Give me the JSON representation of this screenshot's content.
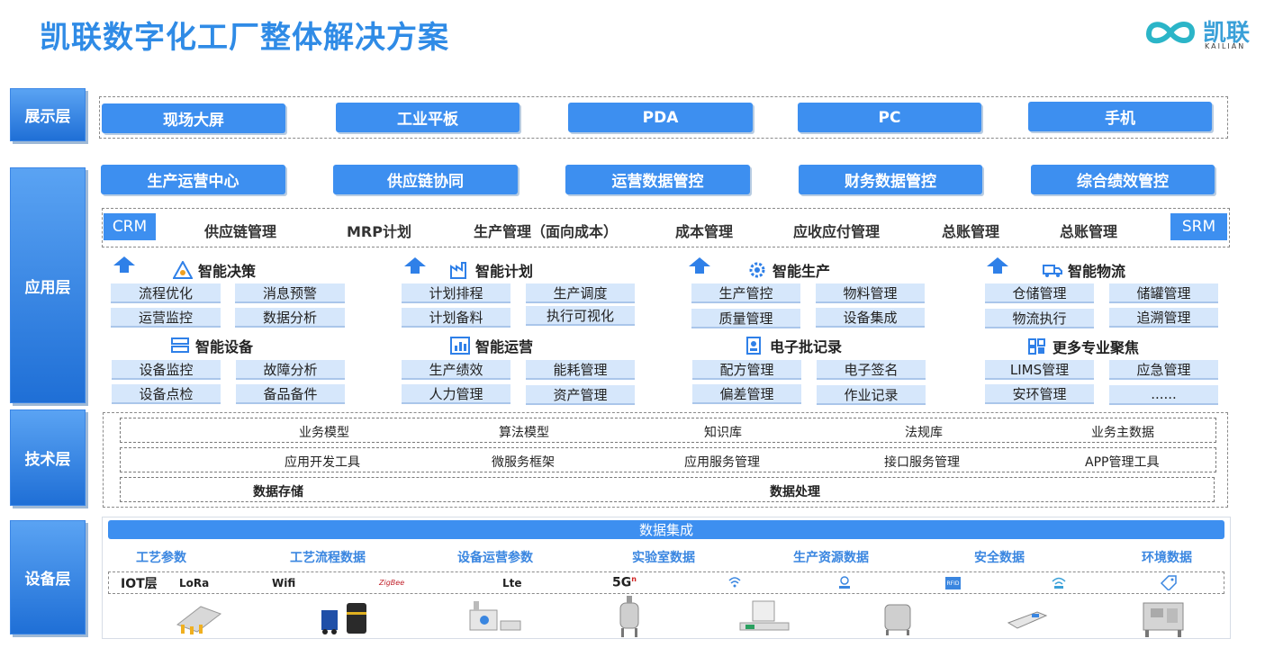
{
  "title": "凯联数字化工厂整体解决方案",
  "logo": {
    "name": "凯联",
    "sub": "KAILIAN"
  },
  "layers": {
    "display": "展示层",
    "application": "应用层",
    "technology": "技术层",
    "device": "设备层"
  },
  "display_items": [
    "现场大屏",
    "工业平板",
    "PDA",
    "PC",
    "手机"
  ],
  "centers": [
    "生产运营中心",
    "供应链协同",
    "运营数据管控",
    "财务数据管控",
    "综合绩效管控"
  ],
  "erp_row": {
    "left_tag": "CRM",
    "items": [
      "供应链管理",
      "MRP计划",
      "生产管理（面向成本）",
      "成本管理",
      "应收应付管理",
      "总账管理",
      "总账管理"
    ],
    "right_tag": "SRM"
  },
  "modules": [
    {
      "title": "智能决策",
      "icon": "decision-icon",
      "items": [
        "流程优化",
        "消息预警",
        "运营监控",
        "数据分析"
      ]
    },
    {
      "title": "智能计划",
      "icon": "factory-icon",
      "items": [
        "计划排程",
        "生产调度",
        "计划备料",
        "执行可视化"
      ]
    },
    {
      "title": "智能生产",
      "icon": "gear-icon",
      "items": [
        "生产管控",
        "物料管理",
        "质量管理",
        "设备集成"
      ]
    },
    {
      "title": "智能物流",
      "icon": "truck-icon",
      "items": [
        "仓储管理",
        "储罐管理",
        "物流执行",
        "追溯管理"
      ]
    },
    {
      "title": "智能设备",
      "icon": "server-icon",
      "items": [
        "设备监控",
        "故障分析",
        "设备点检",
        "备品备件"
      ]
    },
    {
      "title": "智能运营",
      "icon": "bar-chart-icon",
      "items": [
        "生产绩效",
        "能耗管理",
        "人力管理",
        "资产管理"
      ]
    },
    {
      "title": "电子批记录",
      "icon": "document-user-icon",
      "items": [
        "配方管理",
        "电子签名",
        "偏差管理",
        "作业记录"
      ]
    },
    {
      "title": "更多专业聚焦",
      "icon": "grid-icon",
      "items": [
        "LIMS管理",
        "应急管理",
        "安环管理",
        "......"
      ]
    }
  ],
  "tech": {
    "row1": [
      "业务模型",
      "算法模型",
      "知识库",
      "法规库",
      "业务主数据"
    ],
    "row2": [
      "应用开发工具",
      "微服务框架",
      "应用服务管理",
      "接口服务管理",
      "APP管理工具"
    ],
    "row3": [
      "数据存储",
      "数据处理"
    ]
  },
  "device": {
    "integration": "数据集成",
    "categories": [
      "工艺参数",
      "工艺流程数据",
      "设备运营参数",
      "实验室数据",
      "生产资源数据",
      "安全数据",
      "环境数据"
    ],
    "iot_label": "IOT层",
    "protocols": [
      "LoRa",
      "Wifi",
      "ZigBee",
      "Lte",
      "5G",
      "",
      "",
      "RFID",
      "",
      ""
    ],
    "equipment": [
      "production-line-icon",
      "tank-forklift-icon",
      "lab-instrument-icon",
      "reactor-icon",
      "balance-icon",
      "storage-tank-icon",
      "scanner-icon",
      "packaging-machine-icon"
    ]
  },
  "colors": {
    "primary": "#3d8ff0",
    "chip": "#d6e7fb",
    "title": "#2f8be6"
  }
}
